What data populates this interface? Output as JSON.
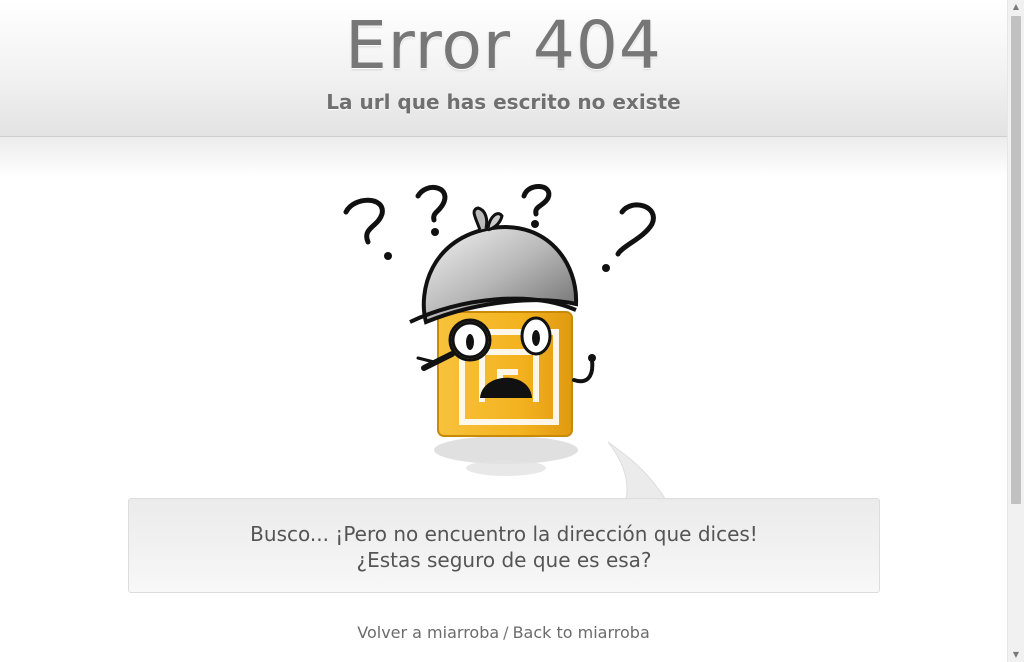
{
  "header": {
    "title": "Error 404",
    "subtitle": "La url que has escrito no existe"
  },
  "illustration": {
    "icon": "confused-detective-mascot-icon",
    "colors": {
      "body": "#f3b21f",
      "hat": "#bdbdbd",
      "ink": "#111111"
    }
  },
  "bubble": {
    "line1": "Busco... ¡Pero no encuentro la dirección que dices!",
    "line2": "¿Estas seguro de que es esa?"
  },
  "footer": {
    "link_es": "Volver a miarroba",
    "separator": "/",
    "link_en": "Back to miarroba"
  },
  "scrollbar": {
    "up_icon": "▲",
    "down_icon": "▼"
  }
}
